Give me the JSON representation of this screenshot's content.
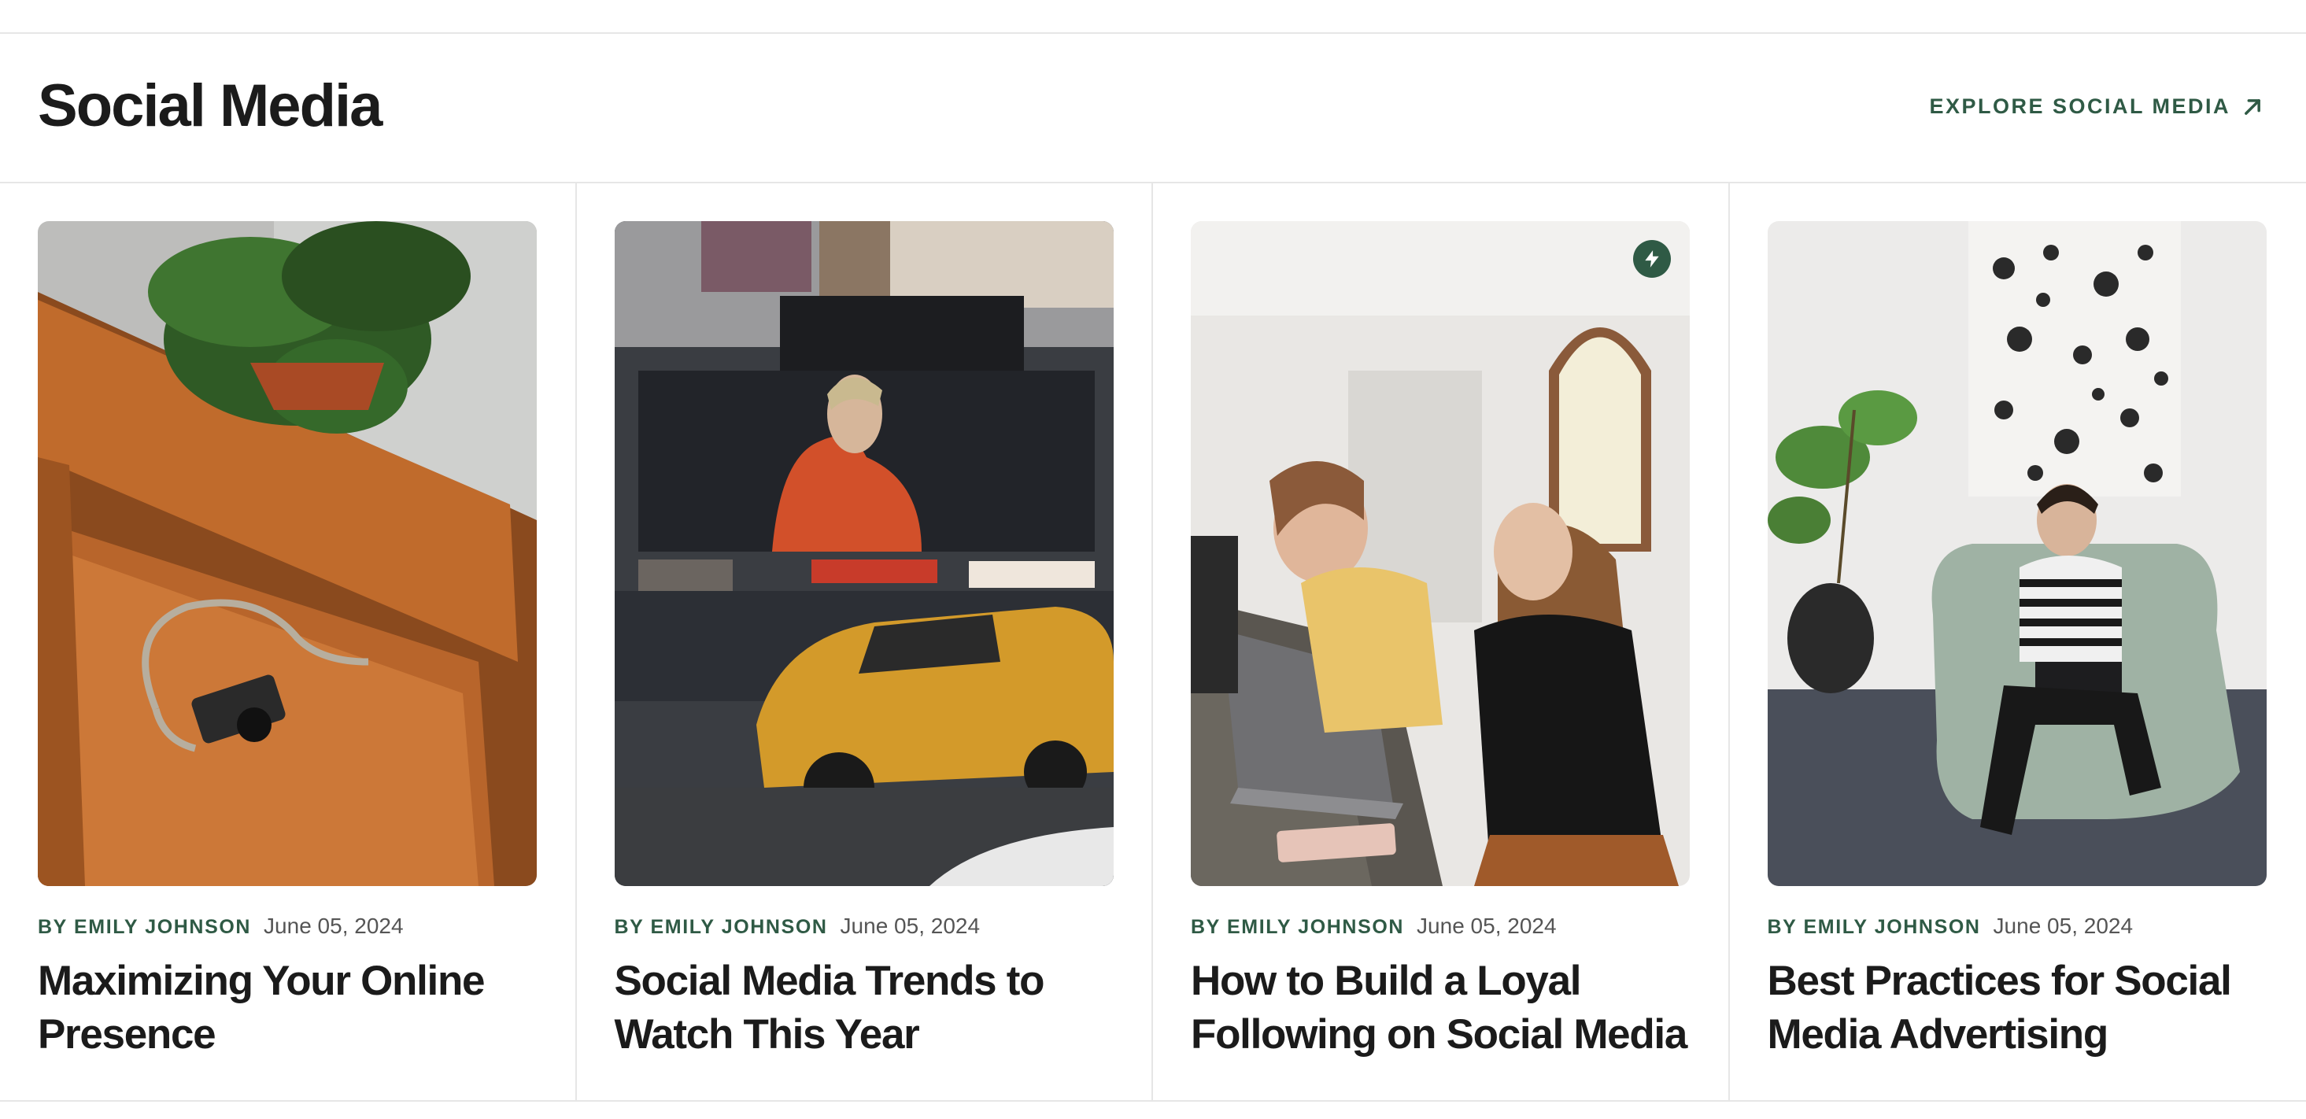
{
  "section": {
    "title": "Social Media",
    "explore_label": "EXPLORE SOCIAL MEDIA",
    "explore_icon": "arrow-up-right-icon"
  },
  "colors": {
    "accent": "#2f5a45",
    "text": "#1b1b1b",
    "muted": "#555555",
    "divider": "#e6e6e6"
  },
  "cards": [
    {
      "author": "BY EMILY JOHNSON",
      "date": "June 05, 2024",
      "title": "Maximizing Your Online Presence",
      "image": "leather-armchair-camera-plant-photo",
      "badge": null
    },
    {
      "author": "BY EMILY JOHNSON",
      "date": "June 05, 2024",
      "title": "Social Media Trends to Watch This Year",
      "image": "times-square-billboard-taxi-photo",
      "badge": null
    },
    {
      "author": "BY EMILY JOHNSON",
      "date": "June 05, 2024",
      "title": "How to Build a Loyal Following on Social Media",
      "image": "two-women-laptop-office-photo",
      "badge": "lightning-bolt-icon"
    },
    {
      "author": "BY EMILY JOHNSON",
      "date": "June 05, 2024",
      "title": "Best Practices for Social Media Advertising",
      "image": "man-laptop-beanbag-photo",
      "badge": null
    }
  ]
}
